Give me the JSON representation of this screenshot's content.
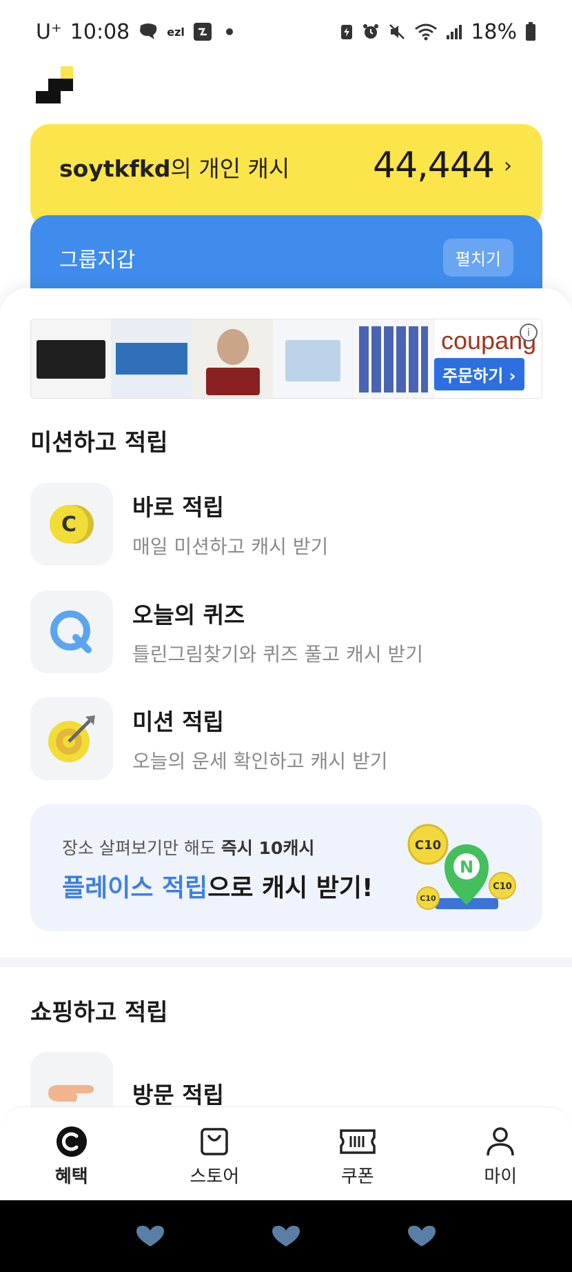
{
  "status_bar": {
    "carrier": "U⁺",
    "time": "10:08",
    "app_icon_label": "ezl",
    "battery": "18%"
  },
  "cash_card": {
    "username": "soytkfkd",
    "label_suffix": "의 개인 캐시",
    "amount": "44,444",
    "chevron": "›"
  },
  "group_wallet": {
    "label": "그룹지갑",
    "expand_button": "펼치기"
  },
  "ad_banner": {
    "brand": "coupang",
    "cta": "주문하기 ›",
    "info": "i"
  },
  "mission_section": {
    "title": "미션하고 적립",
    "items": [
      {
        "title": "바로 적립",
        "desc": "매일 미션하고 캐시 받기",
        "icon": "cash-coin-icon"
      },
      {
        "title": "오늘의 퀴즈",
        "desc": "틀린그림찾기와 퀴즈 풀고 캐시 받기",
        "icon": "quiz-q-icon"
      },
      {
        "title": "미션 적립",
        "desc": "오늘의 운세 확인하고 캐시 받기",
        "icon": "target-dart-icon"
      }
    ]
  },
  "place_banner": {
    "sub_prefix": "장소 살펴보기만 해도 ",
    "sub_bold": "즉시 10캐시",
    "main_accent": "플레이스 적립",
    "main_rest": "으로 캐시 받기!",
    "coin_label_large": "C10",
    "coin_label_small": "C10",
    "coin_label_right": "C10",
    "pin_letter": "N"
  },
  "shopping_section": {
    "title": "쇼핑하고 적립",
    "items": [
      {
        "title": "방문 적립",
        "icon": "pointing-hand-icon"
      }
    ]
  },
  "bottom_nav": {
    "items": [
      {
        "label": "혜택",
        "icon": "cash-c-icon",
        "active": true
      },
      {
        "label": "스토어",
        "icon": "shopping-bag-icon",
        "active": false
      },
      {
        "label": "쿠폰",
        "icon": "ticket-icon",
        "active": false
      },
      {
        "label": "마이",
        "icon": "person-icon",
        "active": false
      }
    ]
  },
  "colors": {
    "cash_card_bg": "#FBE54A",
    "group_wallet_bg": "#3F8CEC",
    "accent_blue": "#3F7FE0",
    "icon_box_bg": "#F3F4F6",
    "place_banner_bg": "#EFF3FC"
  }
}
